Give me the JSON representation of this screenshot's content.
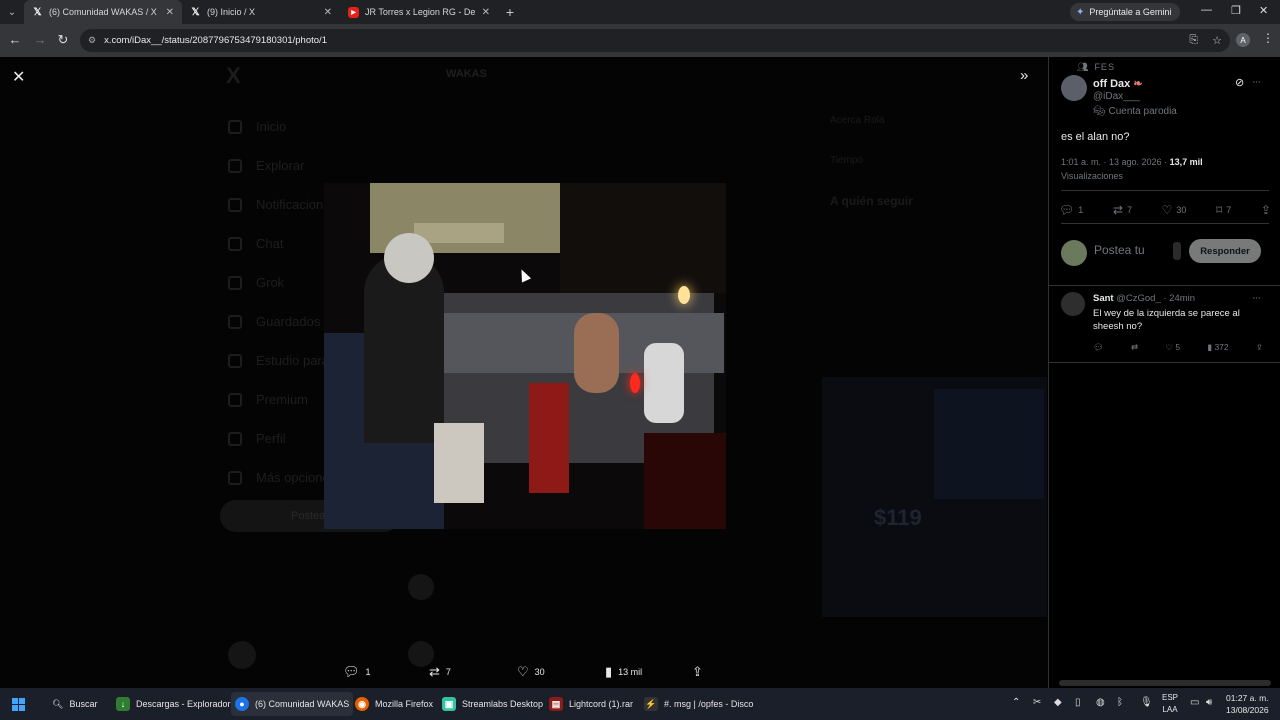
{
  "browser": {
    "tabs": [
      {
        "label": "(6) Comunidad WAKAS / X",
        "favicon": "X",
        "active": true
      },
      {
        "label": "(9) Inicio / X",
        "favicon": "X",
        "active": false
      },
      {
        "label": "JR Torres x Legion RG - De Hech",
        "favicon": "yt",
        "active": false
      }
    ],
    "gemini_label": "Pregúntale a Gemini",
    "url": "x.com/iDax__/status/2087796753479180301/photo/1",
    "profile_initial": "A"
  },
  "viewer": {
    "action_bar": {
      "replies": "1",
      "reposts": "7",
      "likes": "30",
      "views": "13 mil"
    }
  },
  "background": {
    "logo": "X",
    "community_title": "WAKAS",
    "nav": [
      "Inicio",
      "Explorar",
      "Notificaciones",
      "Chat",
      "Grok",
      "Guardados",
      "Estudio para",
      "Premium",
      "Perfil",
      "Más opciones"
    ],
    "post_button": "Postear",
    "side": [
      "Acerca Rola",
      "Tiempo",
      "A quién seguir"
    ],
    "ad_price": "$119"
  },
  "tweet": {
    "community": "FES",
    "author_name": "off Dax",
    "author_handle": "@iDax___",
    "parody_label": "Cuenta parodia",
    "text": "es el alan no?",
    "timestamp": "1:01 a. m. · 13 ago. 2026 ·",
    "views_count": "13,7 mil",
    "views_label": "Visualizaciones",
    "stats": {
      "replies": "1",
      "reposts": "7",
      "likes": "30",
      "bookmarks": "7"
    },
    "reply_placeholder": "Postea tu",
    "reply_button": "Responder"
  },
  "reply": {
    "name": "Sant",
    "handle": "@CzGod_ · 24min",
    "text": "El wey de la izquierda se parece al sheesh no?",
    "likes": "5",
    "views": "372"
  },
  "taskbar": {
    "search_label": "Buscar",
    "apps": [
      {
        "label": "Descargas - Explorador",
        "color": "#2e7d32"
      },
      {
        "label": "(6) Comunidad WAKAS",
        "color": "#1a73e8"
      },
      {
        "label": "Mozilla Firefox",
        "color": "#e66000"
      },
      {
        "label": "Streamlabs Desktop",
        "color": "#31c3a2"
      },
      {
        "label": "Lightcord (1).rar",
        "color": "#8b1a1a"
      },
      {
        "label": "#. msg | /opfes - Disco",
        "color": "#333333"
      }
    ],
    "lang_top": "ESP",
    "lang_bottom": "LAA",
    "time": "01:27 a. m.",
    "date": "13/08/2026"
  }
}
